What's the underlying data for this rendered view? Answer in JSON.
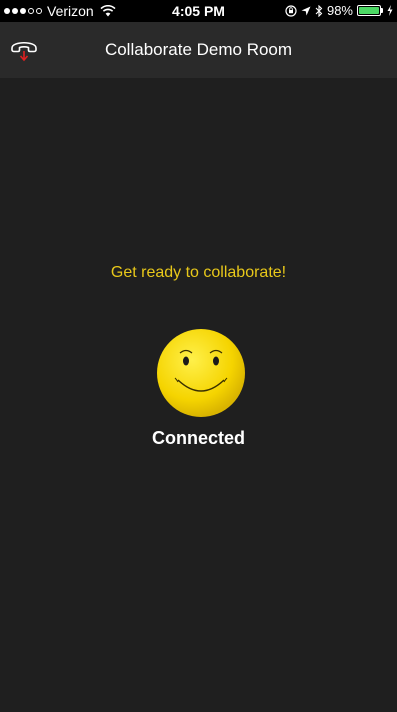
{
  "status_bar": {
    "carrier": "Verizon",
    "time": "4:05 PM",
    "battery_percent": "98%",
    "battery_level": 0.98,
    "icons": [
      "wifi-icon",
      "orientation-lock-icon",
      "location-icon",
      "bluetooth-icon",
      "battery-icon",
      "charging-icon"
    ]
  },
  "nav": {
    "title": "Collaborate Demo Room",
    "hangup_icon": "hang-up-phone-icon"
  },
  "main": {
    "message": "Get ready to collaborate!",
    "status": "Connected",
    "status_icon": "smiley-face-icon"
  },
  "colors": {
    "accent_yellow": "#e8c81a",
    "background": "#1f1f1f",
    "nav_background": "#2a2a2a",
    "hangup_red": "#e02020",
    "battery_green": "#4cd964"
  }
}
